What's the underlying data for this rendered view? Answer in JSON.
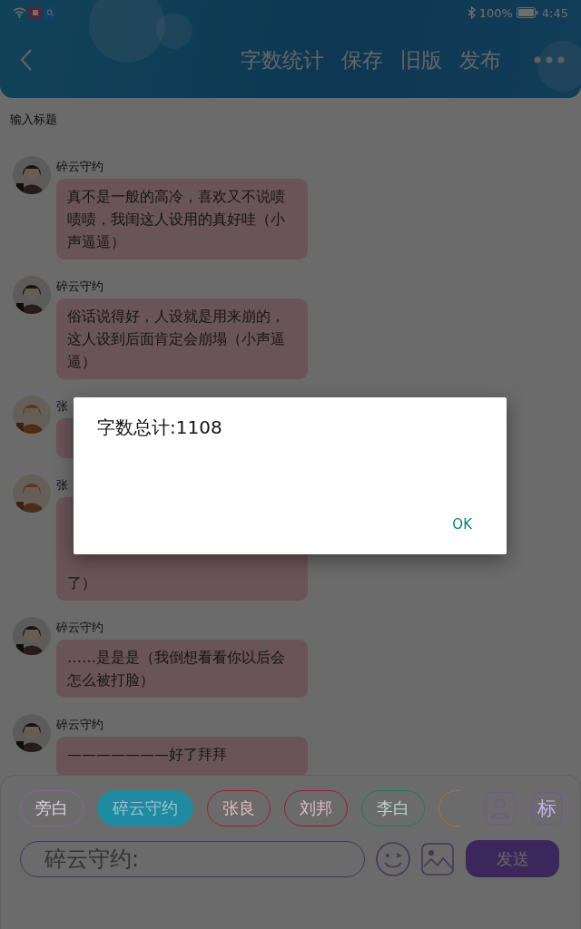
{
  "status_bar": {
    "battery": "100%",
    "time": "4:45"
  },
  "toolbar": {
    "actions": [
      "字数统计",
      "保存",
      "旧版",
      "发布"
    ]
  },
  "title_field": {
    "placeholder": "输入标题"
  },
  "messages": [
    {
      "speaker": "碎云守约",
      "text": "真不是一般的高冷，喜欢又不说啧啧啧，我闺这人设用的真好哇（小声逼逼）"
    },
    {
      "speaker": "碎云守约",
      "text": "俗话说得好，人设就是用来崩的，这人设到后面肯定会崩塌（小声逼逼）"
    },
    {
      "speaker": "张",
      "kind": "covered"
    },
    {
      "speaker": "张",
      "kind": "covered_tail",
      "text": "了）"
    },
    {
      "speaker": "碎云守约",
      "text": "……是是是（我倒想看看你以后会怎么被打脸）"
    },
    {
      "speaker": "碎云守约",
      "text": "———————好了拜拜"
    }
  ],
  "roles": [
    {
      "label": "旁白",
      "color": "#86649a",
      "selected": false
    },
    {
      "label": "碎云守约",
      "color": "#1f8aa0",
      "selected": true
    },
    {
      "label": "张良",
      "color": "#a02424",
      "selected": false
    },
    {
      "label": "刘邦",
      "color": "#9a1c3c",
      "selected": false
    },
    {
      "label": "李白",
      "color": "#1e7a5a",
      "selected": false
    },
    {
      "color": "#b07030",
      "selected": false
    }
  ],
  "tag_button": "标",
  "composer": {
    "value": "碎云守约:",
    "send": "发送"
  },
  "dialog": {
    "message": "字数总计:1108",
    "button": "OK"
  }
}
